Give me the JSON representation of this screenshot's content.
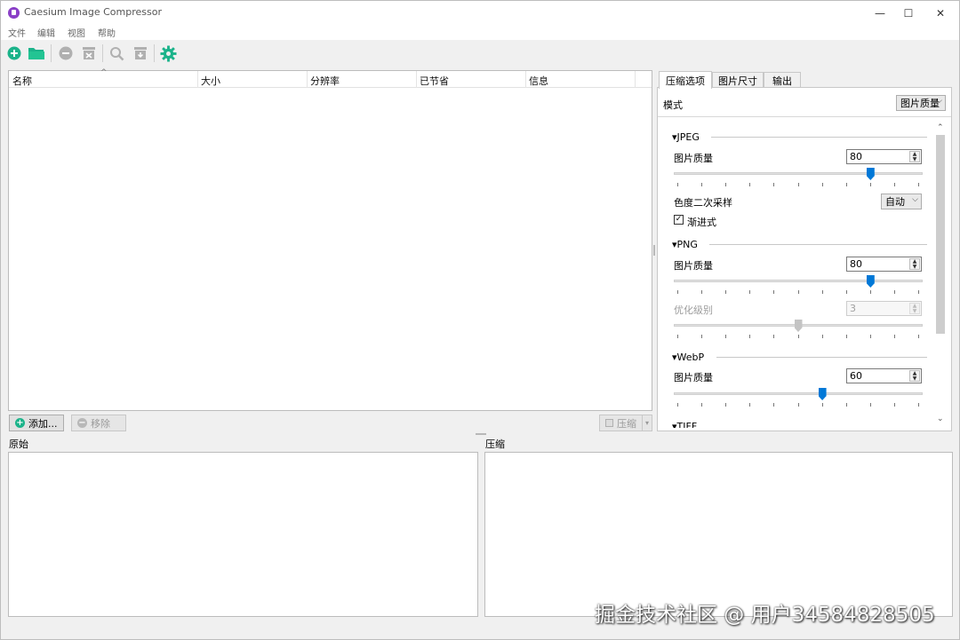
{
  "window": {
    "title": "Caesium Image Compressor",
    "minimize": "—",
    "maximize": "☐",
    "close": "✕"
  },
  "menu": {
    "items": [
      "文件",
      "编辑",
      "视图",
      "帮助"
    ]
  },
  "toolbar": {
    "icons": [
      "add-icon",
      "open-folder-icon",
      "remove-icon",
      "clear-icon",
      "preview-icon",
      "compress-icon",
      "settings-icon"
    ],
    "accent": "#1bb38a"
  },
  "table": {
    "columns": [
      "名称",
      "大小",
      "分辨率",
      "已节省",
      "信息"
    ],
    "rows": []
  },
  "actions": {
    "add_label": "添加...",
    "remove_label": "移除",
    "compress_label": "压缩"
  },
  "preview": {
    "original_label": "原始",
    "compressed_label": "压缩"
  },
  "options": {
    "tabs": [
      "压缩选项",
      "图片尺寸",
      "输出"
    ],
    "mode_label": "模式",
    "mode_value": "图片质量",
    "jpeg": {
      "title": "JPEG",
      "quality_label": "图片质量",
      "quality_value": "80",
      "chroma_label": "色度二次采样",
      "chroma_value": "自动",
      "progressive_label": "渐进式",
      "progressive_checked": true,
      "slider_fraction": 0.8
    },
    "png": {
      "title": "PNG",
      "quality_label": "图片质量",
      "quality_value": "80",
      "optimization_label": "优化级别",
      "optimization_value": "3",
      "slider_fraction": 0.8,
      "opt_slider_fraction": 0.5
    },
    "webp": {
      "title": "WebP",
      "quality_label": "图片质量",
      "quality_value": "60",
      "slider_fraction": 0.6
    },
    "tiff": {
      "title": "TIFF"
    }
  },
  "watermark": "掘金技术社区 @ 用户3458482850​5"
}
